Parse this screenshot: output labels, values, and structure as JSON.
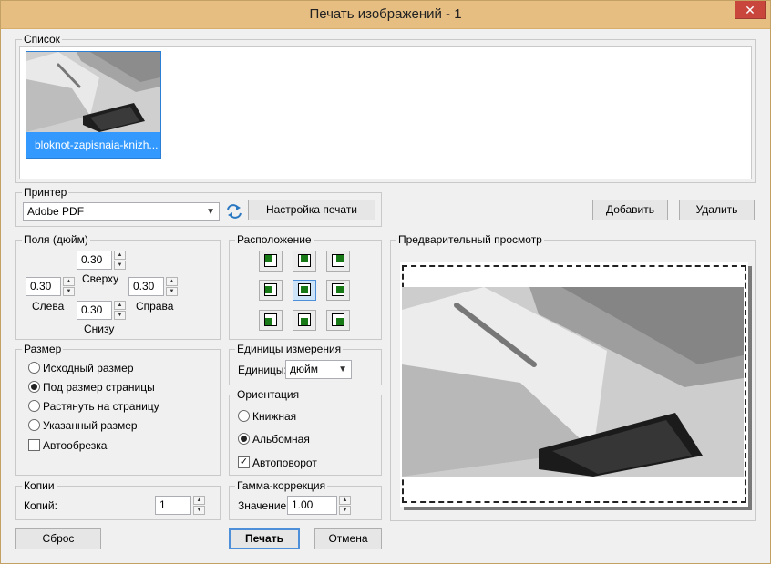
{
  "window": {
    "title": "Печать изображений - 1",
    "close_glyph": "✕"
  },
  "list": {
    "label": "Список",
    "items": [
      {
        "name": "bloknot-zapisnaia-knizh...",
        "selected": true
      }
    ]
  },
  "printer": {
    "label": "Принтер",
    "selected": "Adobe PDF",
    "setup_button": "Настройка печати",
    "refresh_icon": "refresh-icon"
  },
  "list_actions": {
    "add": "Добавить",
    "remove": "Удалить"
  },
  "margins": {
    "label": "Поля (дюйм)",
    "top": {
      "label": "Сверху",
      "value": "0.30"
    },
    "left": {
      "label": "Слева",
      "value": "0.30"
    },
    "right": {
      "label": "Справа",
      "value": "0.30"
    },
    "bottom": {
      "label": "Снизу",
      "value": "0.30"
    }
  },
  "placement": {
    "label": "Расположение",
    "selected": "center"
  },
  "preview": {
    "label": "Предварительный просмотр"
  },
  "size": {
    "label": "Размер",
    "options": [
      "Исходный размер",
      "Под размер страницы",
      "Растянуть на страницу",
      "Указанный размер"
    ],
    "selected_index": 1,
    "autocrop": {
      "label": "Автообрезка",
      "checked": false
    }
  },
  "units": {
    "label": "Единицы измерения",
    "field_label": "Единицы:",
    "selected": "дюйм"
  },
  "orientation": {
    "label": "Ориентация",
    "options": [
      "Книжная",
      "Альбомная"
    ],
    "selected_index": 1,
    "autorotate": {
      "label": "Автоповорот",
      "checked": true
    }
  },
  "copies": {
    "label": "Копии",
    "field_label": "Копий:",
    "value": "1"
  },
  "gamma": {
    "label": "Гамма-коррекция",
    "field_label": "Значение:",
    "value": "1.00"
  },
  "footer": {
    "reset": "Сброс",
    "print": "Печать",
    "cancel": "Отмена"
  },
  "colors": {
    "selection": "#3399ff",
    "title_bar": "#e6be82",
    "close": "#c9463d"
  }
}
